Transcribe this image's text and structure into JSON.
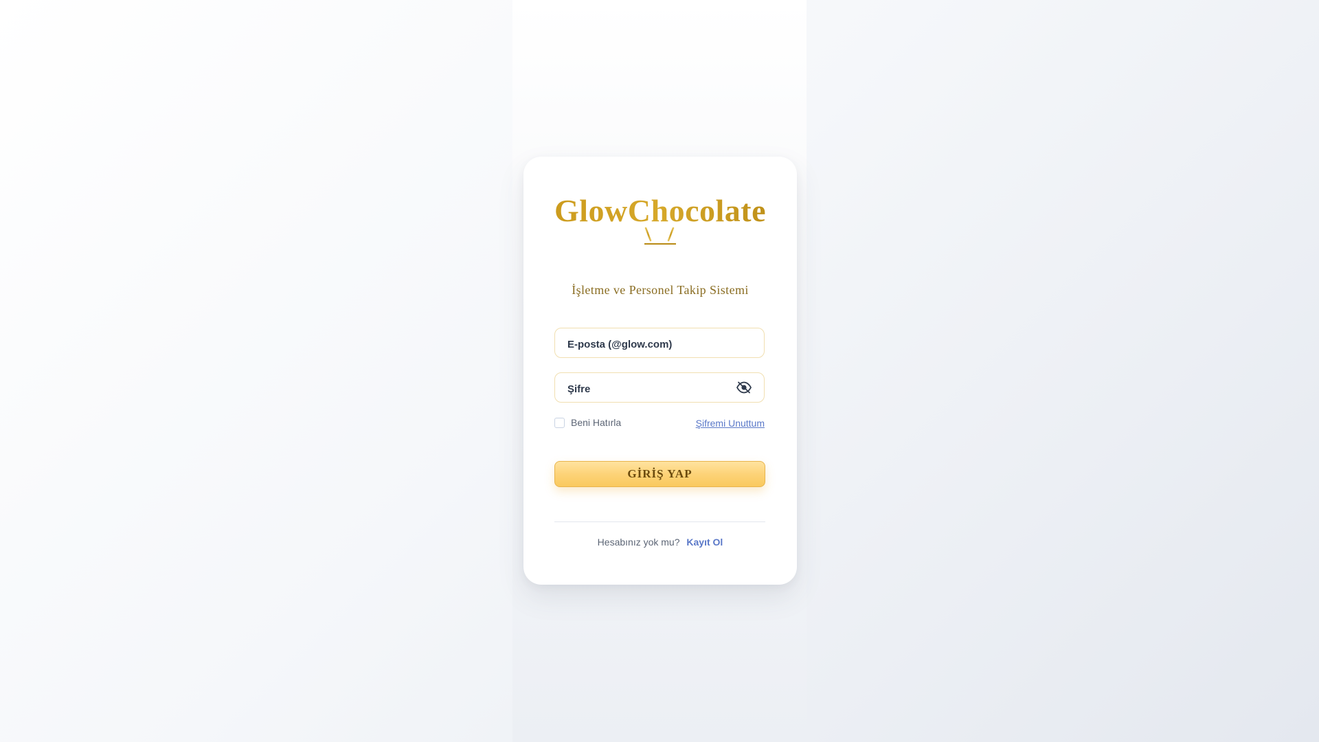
{
  "brand": {
    "name": "GlowChocolate",
    "subtitle": "İşletme ve Personel Takip Sistemi"
  },
  "form": {
    "email_placeholder": "E-posta (@glow.com)",
    "password_placeholder": "Şifre",
    "remember_label": "Beni Hatırla",
    "forgot_label": "Şifremi Unuttum",
    "login_label": "GİRİŞ YAP"
  },
  "footer": {
    "question": "Hesabınız yok mu?",
    "signup_label": "Kayıt Ol"
  },
  "icons": {
    "crown": "crown-icon",
    "password_toggle": "eye-icon"
  },
  "colors": {
    "brand_gold": "#c89a1e",
    "subtitle_brown": "#8a6d22",
    "button_gold": "#fdd378",
    "link_blue": "#5a78c8"
  }
}
